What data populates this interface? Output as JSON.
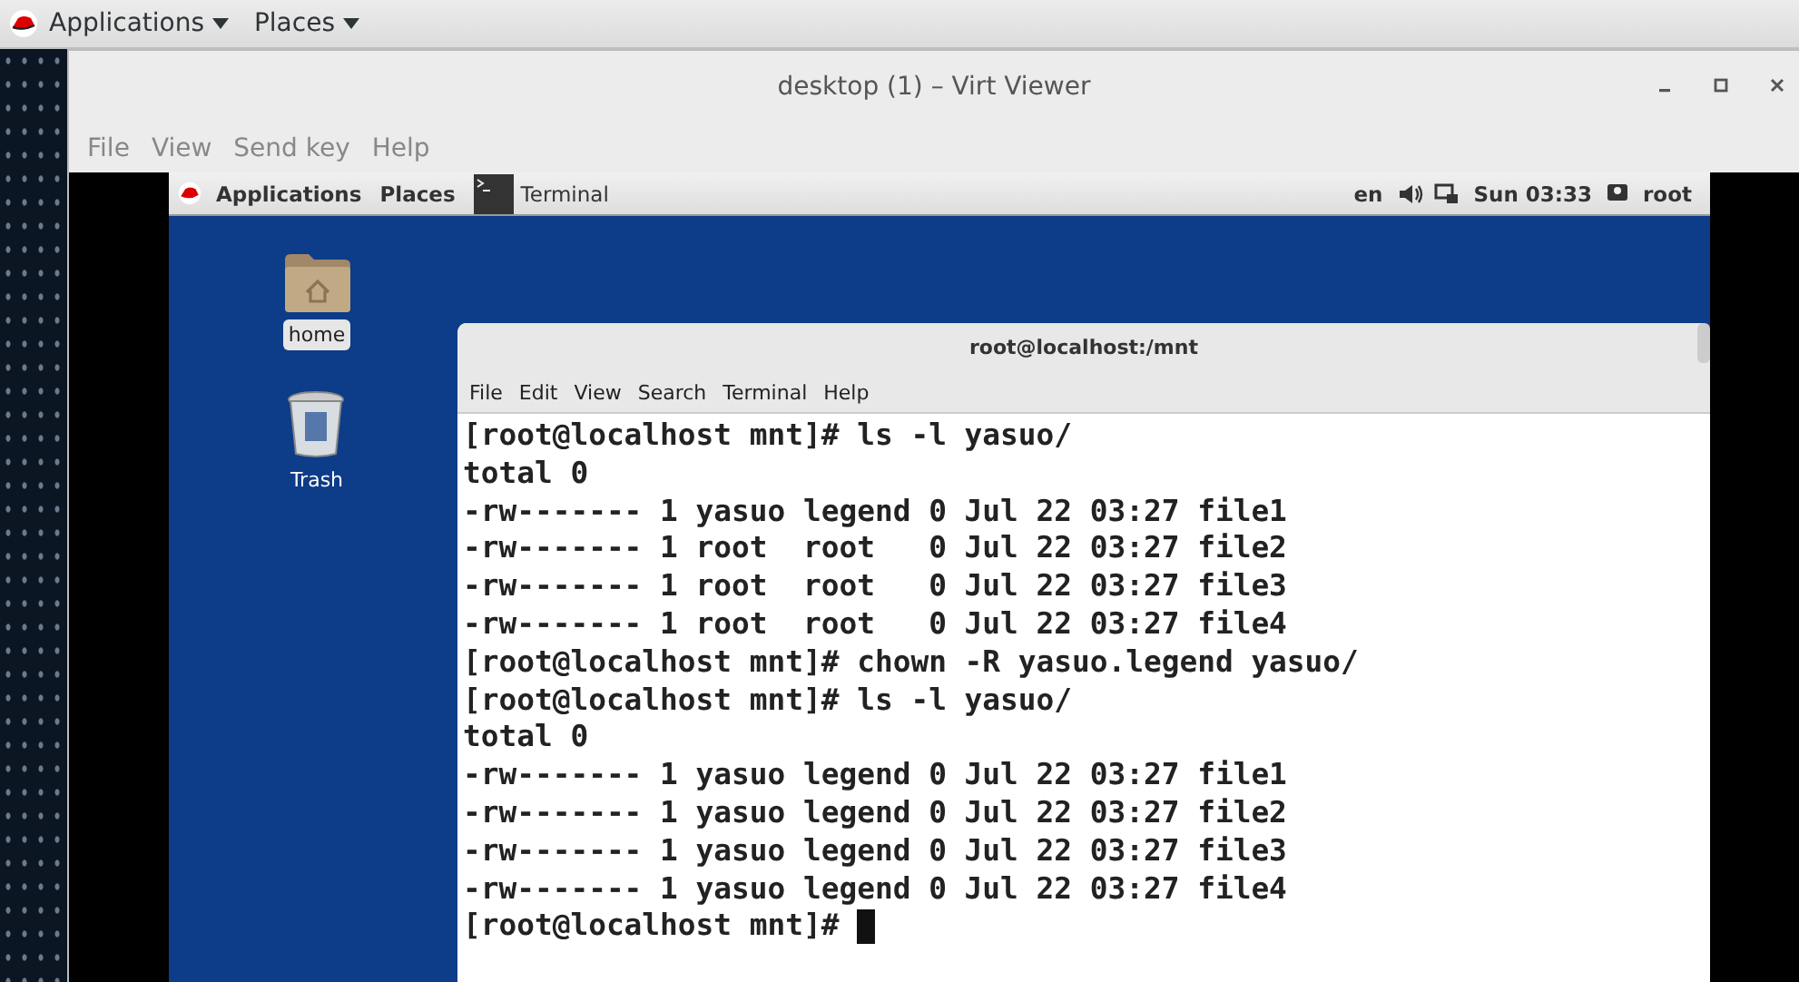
{
  "host_top_bar": {
    "menus": [
      "Applications",
      "Places"
    ]
  },
  "window": {
    "title": "desktop (1) – Virt Viewer",
    "menu": [
      "File",
      "View",
      "Send key",
      "Help"
    ]
  },
  "guest": {
    "top_bar": {
      "menus": [
        "Applications",
        "Places"
      ],
      "task": "Terminal",
      "keyboard": "en",
      "clock": "Sun 03:33",
      "user": "root"
    },
    "desktop_icons": [
      {
        "label": "home",
        "kind": "folder",
        "selected": true
      },
      {
        "label": "Trash",
        "kind": "trash",
        "selected": false
      }
    ],
    "terminal": {
      "title": "root@localhost:/mnt",
      "menu": [
        "File",
        "Edit",
        "View",
        "Search",
        "Terminal",
        "Help"
      ],
      "lines": [
        "[root@localhost mnt]# ls -l yasuo/",
        "total 0",
        "-rw------- 1 yasuo legend 0 Jul 22 03:27 file1",
        "-rw------- 1 root  root   0 Jul 22 03:27 file2",
        "-rw------- 1 root  root   0 Jul 22 03:27 file3",
        "-rw------- 1 root  root   0 Jul 22 03:27 file4",
        "[root@localhost mnt]# chown -R yasuo.legend yasuo/",
        "[root@localhost mnt]# ls -l yasuo/",
        "total 0",
        "-rw------- 1 yasuo legend 0 Jul 22 03:27 file1",
        "-rw------- 1 yasuo legend 0 Jul 22 03:27 file2",
        "-rw------- 1 yasuo legend 0 Jul 22 03:27 file3",
        "-rw------- 1 yasuo legend 0 Jul 22 03:27 file4"
      ],
      "prompt": "[root@localhost mnt]#",
      "cursor": true
    }
  }
}
